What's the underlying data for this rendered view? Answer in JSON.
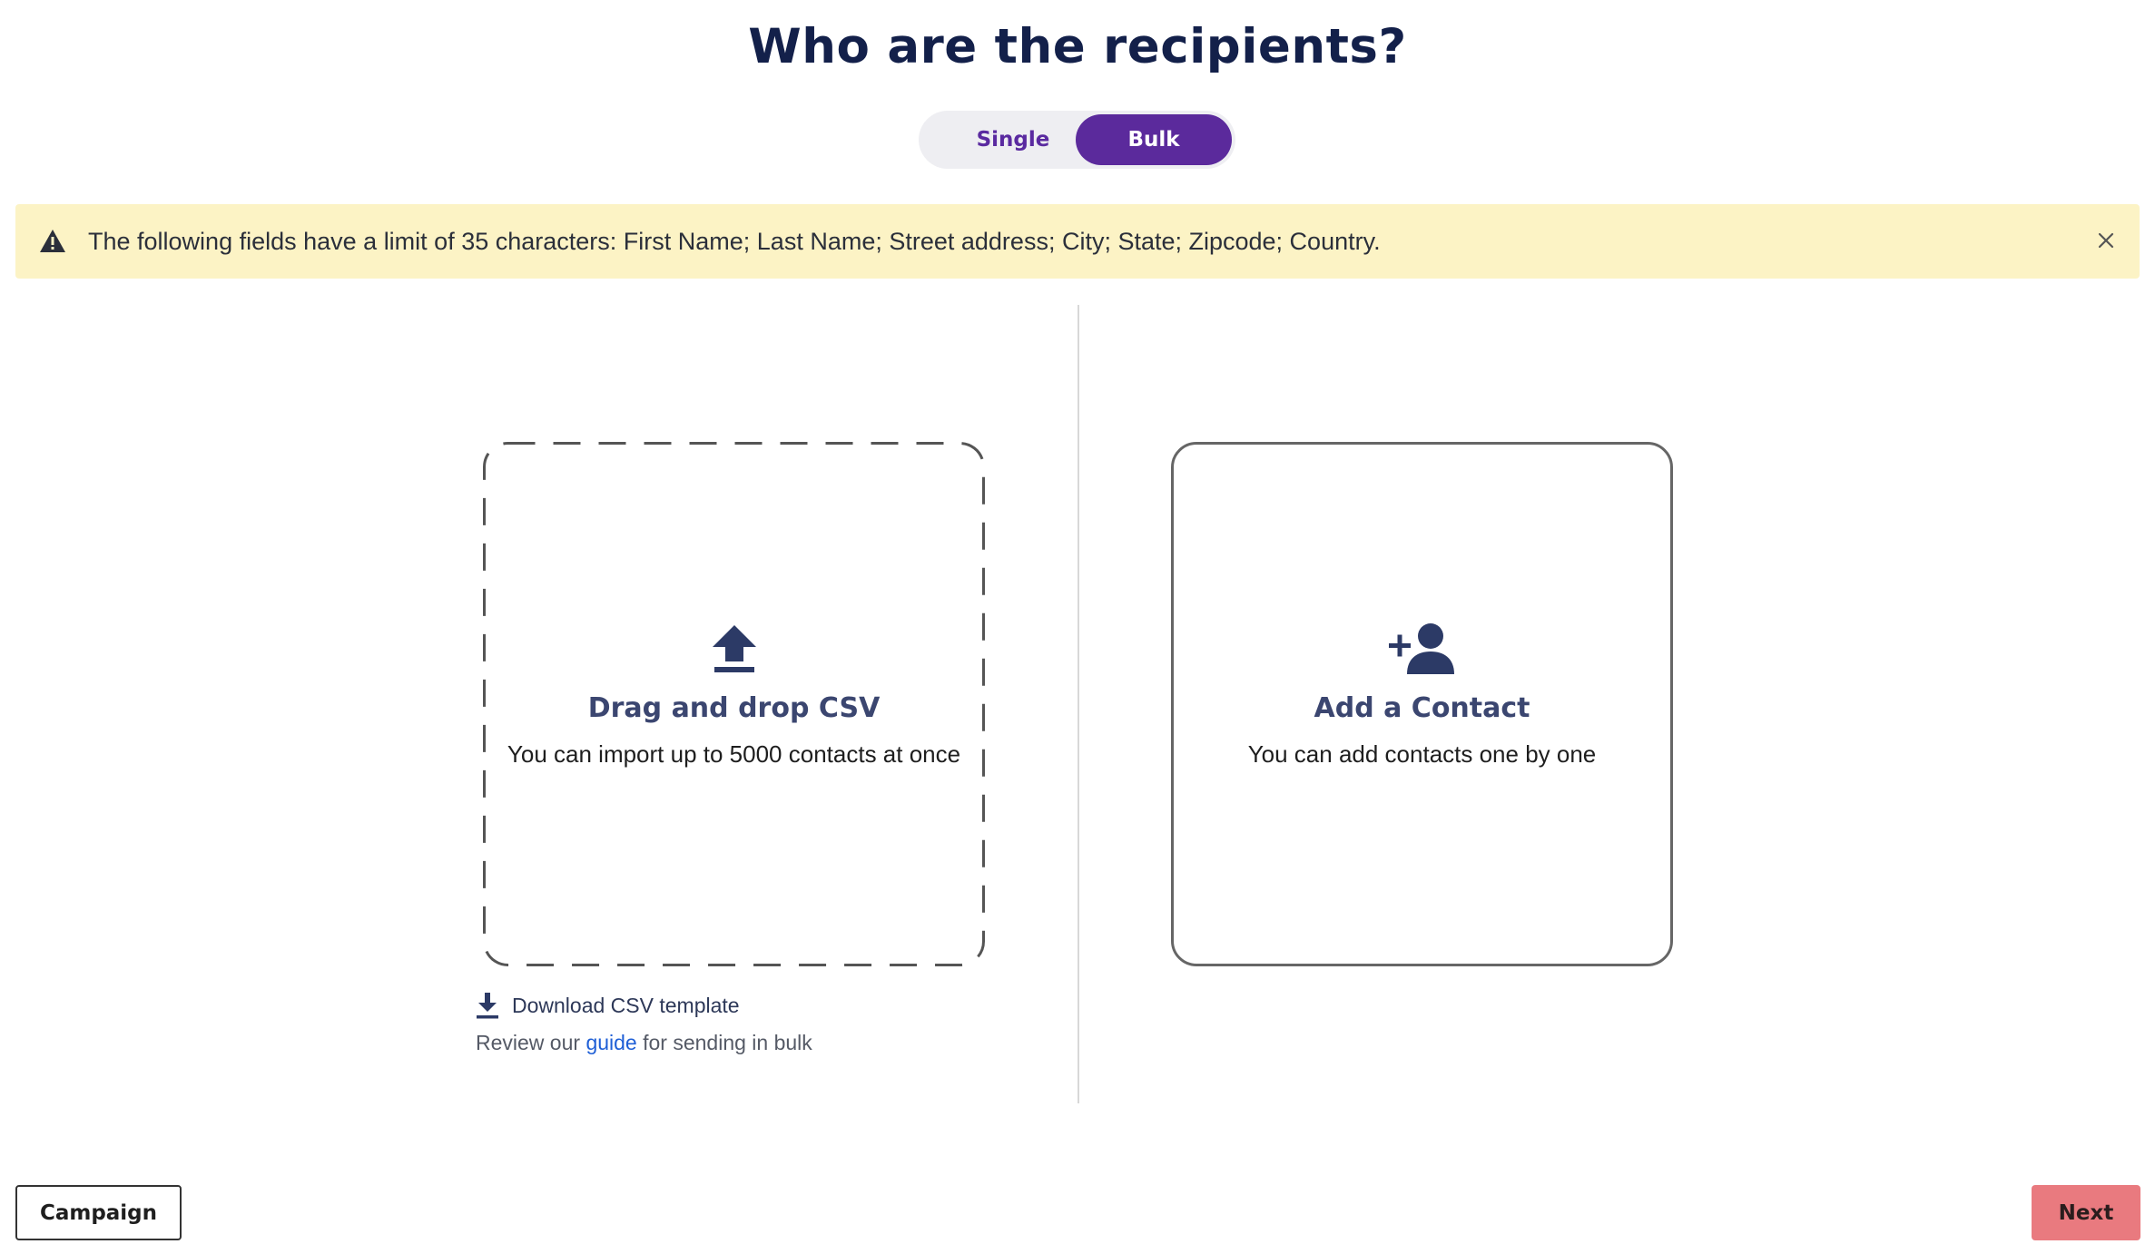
{
  "page": {
    "title": "Who are the recipients?"
  },
  "toggle": {
    "single_label": "Single",
    "bulk_label": "Bulk",
    "selected": "Bulk"
  },
  "alert": {
    "message": "The following fields have a limit of 35 characters: First Name; Last Name; Street address; City; State; Zipcode; Country.",
    "icon": "warning-triangle-icon",
    "close_icon": "close-icon",
    "background": "#fcf3c5"
  },
  "csv_card": {
    "icon": "upload-icon",
    "title": "Drag and drop CSV",
    "subtitle": "You can import up to 5000 contacts at once"
  },
  "contact_card": {
    "icon": "add-person-icon",
    "title": "Add a Contact",
    "subtitle": "You can add contacts one by one"
  },
  "download": {
    "icon": "download-icon",
    "label": "Download CSV template"
  },
  "review": {
    "prefix": "Review our ",
    "link_label": "guide",
    "suffix": " for sending in bulk"
  },
  "footer": {
    "back_label": "Campaign",
    "next_label": "Next"
  },
  "colors": {
    "accent": "#5b2a9c",
    "heading": "#13204a",
    "next_button": "#e97a7f",
    "link": "#1f5fd6"
  }
}
